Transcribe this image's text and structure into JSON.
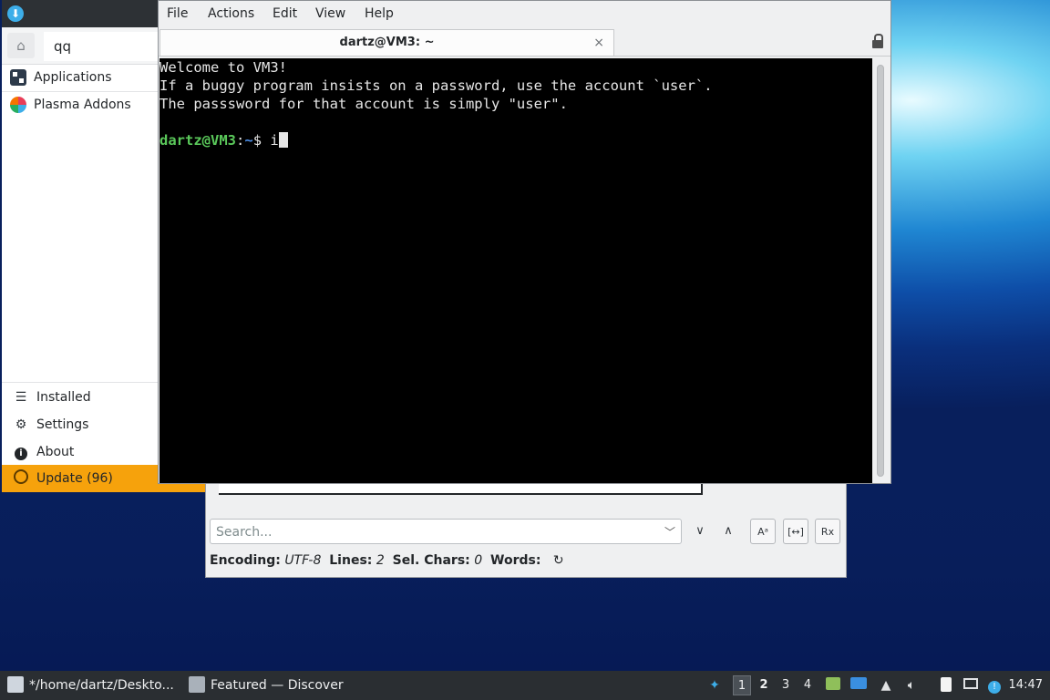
{
  "discover": {
    "search_value": "qq",
    "categories": [
      {
        "label": "Applications",
        "icon": "applications-icon"
      },
      {
        "label": "Plasma Addons",
        "icon": "plasma-addons-icon"
      }
    ],
    "nav": [
      {
        "label": "Installed",
        "icon": "list-icon"
      },
      {
        "label": "Settings",
        "icon": "gear-icon"
      },
      {
        "label": "About",
        "icon": "info-icon"
      },
      {
        "label": "Update (96)",
        "icon": "update-icon"
      }
    ]
  },
  "terminal": {
    "menu": [
      "File",
      "Actions",
      "Edit",
      "View",
      "Help"
    ],
    "tab_title": "dartz@VM3: ~",
    "lines": [
      "Welcome to VM3!",
      "If a buggy program insists on a password, use the account `user`.",
      "The passsword for that account is simply \"user\"."
    ],
    "prompt_user": "dartz@VM3",
    "prompt_sep": ":",
    "prompt_path": "~",
    "prompt_dollar": "$ ",
    "typed": "i"
  },
  "kate": {
    "search_placeholder": "Search...",
    "status": {
      "encoding_label": "Encoding:",
      "encoding_value": "UTF-8",
      "lines_label": "Lines:",
      "lines_value": "2",
      "sel_label": "Sel. Chars:",
      "sel_value": "0",
      "words_label": "Words:"
    }
  },
  "taskbar": {
    "tasks": [
      {
        "label": "*/home/dartz/Deskto...",
        "icon": "text-editor-icon"
      },
      {
        "label": "Featured — Discover",
        "icon": "discover-icon"
      }
    ],
    "workspaces": [
      "1",
      "2",
      "3",
      "4"
    ],
    "active_workspace": "1",
    "clock": "14:47"
  },
  "colors": {
    "accent_update": "#f6a20c",
    "prompt_user": "#5ac85a",
    "prompt_path": "#4d8fe8"
  }
}
